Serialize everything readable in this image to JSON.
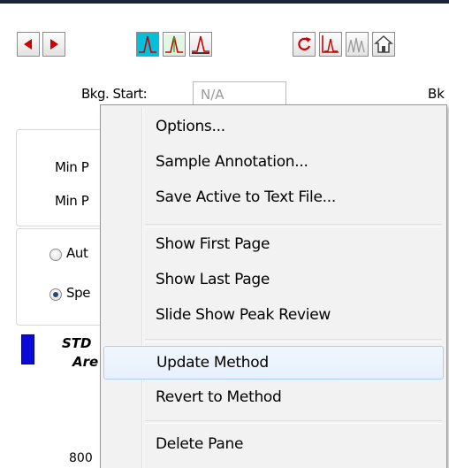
{
  "toolbar": {
    "buttons": [
      {
        "name": "prev-icon",
        "color": "#cc0000"
      },
      {
        "name": "next-icon",
        "color": "#cc0000"
      },
      {
        "name": "peak-cyan-icon",
        "color": "#00c8e0"
      },
      {
        "name": "peak-green-icon",
        "color": "#3ccf3c"
      },
      {
        "name": "peak-baseline-icon",
        "color": "#cc0000"
      },
      {
        "name": "refresh-icon",
        "color": "#cc0000"
      },
      {
        "name": "peak-chart-icon",
        "color": "#cc0000"
      },
      {
        "name": "multi-peak-icon",
        "color": "#9a9a9a"
      },
      {
        "name": "home-icon",
        "color": "#555555"
      }
    ]
  },
  "background": {
    "bkg_start_label": "Bkg. Start:",
    "bkg_start_value": "N/A",
    "bkg_right_partial": "Bk",
    "min_label_1": "Min P",
    "min_label_2": "Min P",
    "radio_1_label": "Aut",
    "radio_2_label": "Spe",
    "std_label": "STD",
    "area_label": "Are",
    "axis_value": "800",
    "swatch_color": "#0a0ad8"
  },
  "context_menu": {
    "items": [
      {
        "label": "Options...",
        "group": 1
      },
      {
        "label": "Sample Annotation...",
        "group": 1
      },
      {
        "label": "Save Active to Text File...",
        "group": 1
      },
      {
        "label": "Show First Page",
        "group": 2
      },
      {
        "label": "Show Last Page",
        "group": 2
      },
      {
        "label": "Slide Show Peak Review",
        "group": 2
      },
      {
        "label": "Update Method",
        "group": 3,
        "highlighted": true
      },
      {
        "label": "Revert to Method",
        "group": 3
      },
      {
        "label": "Delete Pane",
        "group": 4
      }
    ]
  }
}
